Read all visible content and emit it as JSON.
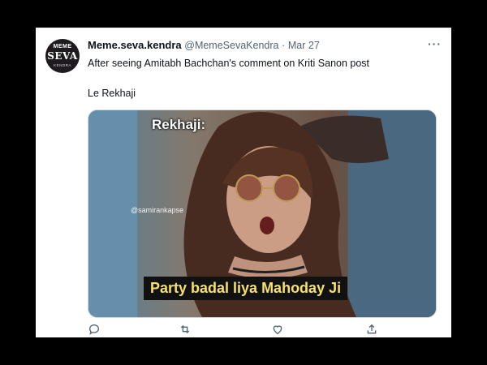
{
  "tweet": {
    "avatar": {
      "line1": "MEME",
      "line2": "SEVA",
      "line3": "KENDRA"
    },
    "author": "Meme.seva.kendra",
    "handle": "@MemeSevaKendra",
    "separator": "·",
    "date": "Mar 27",
    "more": "···",
    "text_line1": "After seeing Amitabh Bachchan's comment on Kriti Sanon post",
    "text_line2": "Le Rekhaji"
  },
  "meme": {
    "top_text": "Rekhaji:",
    "watermark": "@samirankapse",
    "caption": "Party badal liya Mahoday Ji"
  },
  "actions": [
    "reply-icon",
    "retweet-icon",
    "like-icon",
    "share-icon"
  ],
  "colors": {
    "text": "#0f1419",
    "muted": "#536471",
    "caption_text": "#f7e16a",
    "caption_bg": "#111111"
  }
}
